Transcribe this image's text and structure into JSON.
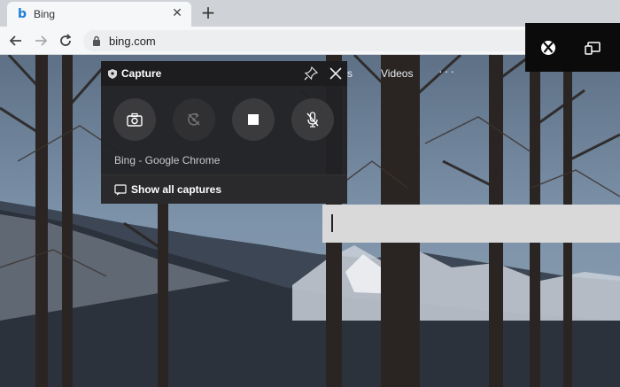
{
  "browser": {
    "tab": {
      "title": "Bing",
      "favicon": "bing-icon"
    },
    "omnibox": {
      "url": "bing.com"
    }
  },
  "bing": {
    "nav_partial": "s",
    "nav_videos": "Videos",
    "nav_more": "···"
  },
  "capture_widget": {
    "title": "Capture",
    "app_name": "Bing - Google Chrome",
    "show_all_label": "Show all captures"
  },
  "colors": {
    "widget_bg": "#222224",
    "widget_button": "#3b3b3e",
    "gamebar_bg": "#0b0b0b",
    "chrome_tabstrip": "#cfd3d8"
  }
}
